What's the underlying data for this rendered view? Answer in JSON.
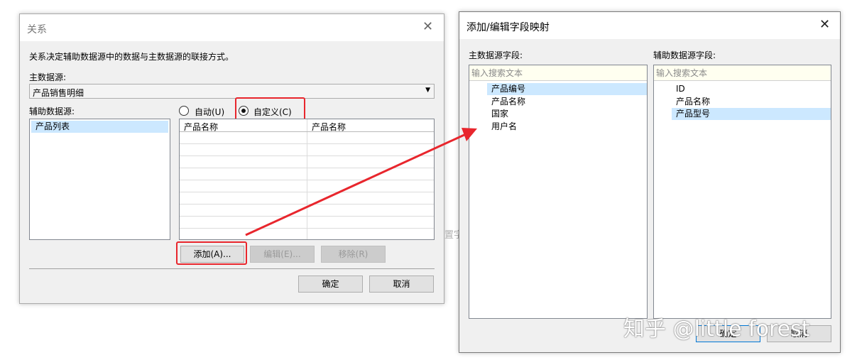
{
  "relation_dialog": {
    "title": "关系",
    "description": "关系决定辅助数据源中的数据与主数据源的联接方式。",
    "primary_source_label": "主数据源:",
    "primary_source_value": "产品销售明细",
    "secondary_source_label": "辅助数据源:",
    "secondary_sources": [
      "产品列表"
    ],
    "radio_auto": "自动(U)",
    "radio_custom": "自定义(C)",
    "columns": [
      "产品名称",
      "产品名称"
    ],
    "add_button": "添加(A)...",
    "edit_button": "编辑(E)...",
    "remove_button": "移除(R)",
    "ok_button": "确定",
    "cancel_button": "取消"
  },
  "mapping_dialog": {
    "title": "添加/编辑字段映射",
    "primary_fields_label": "主数据源字段:",
    "secondary_fields_label": "辅助数据源字段:",
    "search_placeholder_left": "输入搜索文本",
    "search_placeholder_right": "输入搜索文本",
    "primary_fields": [
      "产品编号",
      "产品名称",
      "国家",
      "用户名"
    ],
    "secondary_fields": [
      "ID",
      "产品名称",
      "产品型号"
    ],
    "ok_button": "确定",
    "cancel_button": "取消"
  },
  "overlay": {
    "partial_text": "置字",
    "watermark": "知乎 @little forest",
    "accent_color": "#e8262d"
  }
}
